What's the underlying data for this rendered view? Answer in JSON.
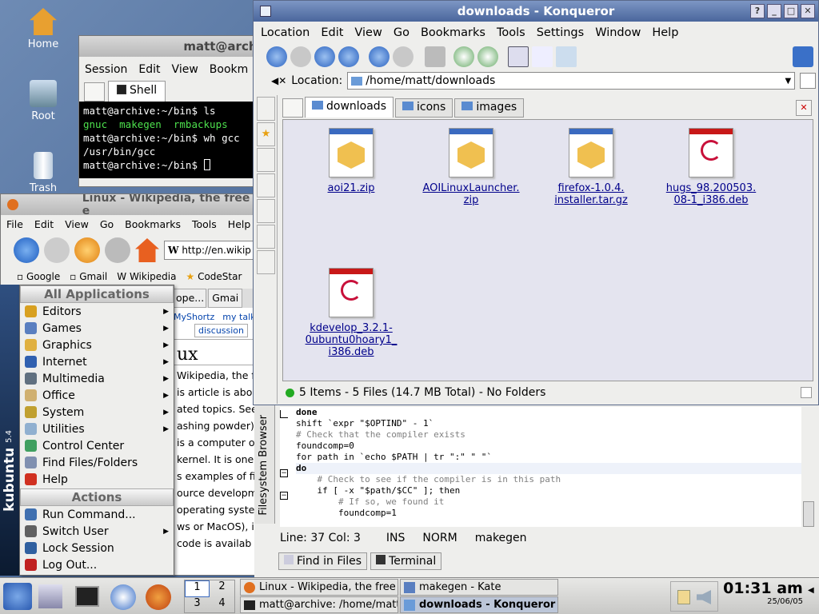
{
  "desktop": {
    "icons": [
      {
        "label": "Home"
      },
      {
        "label": "Root"
      },
      {
        "label": "Trash"
      }
    ]
  },
  "konsole": {
    "title": "matt@archi",
    "menu": [
      "Session",
      "Edit",
      "View",
      "Bookm"
    ],
    "tab": "Shell",
    "lines": [
      {
        "t": "matt@archive:~/bin$ ls",
        "c": "#fff"
      },
      {
        "t": "gnuc  makegen  rmbackups",
        "c": "#4de04d"
      },
      {
        "t": "matt@archive:~/bin$ wh gcc",
        "c": "#fff"
      },
      {
        "t": "/usr/bin/gcc",
        "c": "#fff"
      },
      {
        "t": "matt@archive:~/bin$ ",
        "c": "#fff"
      }
    ]
  },
  "firefox": {
    "title": "Linux - Wikipedia, the free e",
    "menu": [
      "File",
      "Edit",
      "View",
      "Go",
      "Bookmarks",
      "Tools",
      "Help"
    ],
    "url": "http://en.wikip",
    "bookmarks": [
      "Google",
      "Gmail",
      "Wikipedia",
      "CodeStar"
    ],
    "tabs": [
      "ope...",
      "Gmai"
    ],
    "links": [
      "MyShortz",
      "my talk"
    ],
    "subtab": "discussion",
    "heading": "ux",
    "body": [
      "Wikipedia, the fre",
      "is article is abou",
      "ated topics. See",
      "ashing powder)",
      "is a computer o",
      "kernel. It is one",
      "s examples of fi",
      "ource developm",
      "operating syste",
      "ws or MacOS), it",
      "code is availab"
    ]
  },
  "konqueror": {
    "title": "downloads - Konqueror",
    "menu": [
      "Location",
      "Edit",
      "View",
      "Go",
      "Bookmarks",
      "Tools",
      "Settings",
      "Window",
      "Help"
    ],
    "location_label": "Location:",
    "location": "/home/matt/downloads",
    "tabs": [
      "downloads",
      "icons",
      "images"
    ],
    "files": [
      {
        "l1": "aoi21.zip",
        "l2": "",
        "l3": "",
        "type": "TGZ"
      },
      {
        "l1": "AOILinuxLauncher.",
        "l2": "zip",
        "l3": "",
        "type": "TGZ"
      },
      {
        "l1": "firefox-1.0.4.",
        "l2": "installer.tar.gz",
        "l3": "",
        "type": "TGZ"
      },
      {
        "l1": "hugs_98.200503.",
        "l2": "08-1_i386.deb",
        "l3": "",
        "type": "DEB"
      },
      {
        "l1": "kdevelop_3.2.1-",
        "l2": "0ubuntu0hoary1_",
        "l3": "i386.deb",
        "type": "DEB"
      }
    ],
    "status": "5 Items - 5 Files (14.7 MB Total) - No Folders"
  },
  "kate": {
    "sidebar": "Filesystem Browser",
    "code": [
      {
        "t": "done",
        "c": "#000",
        "b": true
      },
      {
        "t": "shift `expr \"$OPTIND\" - 1`",
        "c": "#000",
        "b": false
      },
      {
        "t": "",
        "c": "#000",
        "b": false
      },
      {
        "t": "# Check that the compiler exists",
        "c": "#808080",
        "b": false
      },
      {
        "t": "foundcomp=0",
        "c": "#000",
        "b": false
      },
      {
        "t": "for path in `echo $PATH | tr \":\" \" \"`",
        "c": "#000",
        "b": false
      },
      {
        "t": "do",
        "c": "#000",
        "b": true
      },
      {
        "t": "    # Check to see if the compiler is in this path",
        "c": "#808080",
        "b": false
      },
      {
        "t": "    if [ -x \"$path/$CC\" ]; then",
        "c": "#000",
        "b": false
      },
      {
        "t": "        # If so, we found it",
        "c": "#808080",
        "b": false
      },
      {
        "t": "        foundcomp=1",
        "c": "#000",
        "b": false
      }
    ],
    "status": {
      "pos": "Line: 37 Col: 3",
      "ins": "INS",
      "norm": "NORM",
      "file": "makegen"
    },
    "bottom_tabs": [
      "Find in Files",
      "Terminal"
    ]
  },
  "kmenu": {
    "header": "All Applications",
    "apps": [
      {
        "l": "Editors",
        "a": true,
        "c": "#d8a020"
      },
      {
        "l": "Games",
        "a": true,
        "c": "#5a7fc0"
      },
      {
        "l": "Graphics",
        "a": true,
        "c": "#e0b040"
      },
      {
        "l": "Internet",
        "a": true,
        "c": "#3060b0"
      },
      {
        "l": "Multimedia",
        "a": true,
        "c": "#607080"
      },
      {
        "l": "Office",
        "a": true,
        "c": "#d0b070"
      },
      {
        "l": "System",
        "a": true,
        "c": "#c0a030"
      },
      {
        "l": "Utilities",
        "a": true,
        "c": "#90b0d0"
      },
      {
        "l": "Control Center",
        "a": false,
        "c": "#40a060"
      },
      {
        "l": "Find Files/Folders",
        "a": false,
        "c": "#8090b0"
      },
      {
        "l": "Help",
        "a": false,
        "c": "#d03020"
      }
    ],
    "actions_header": "Actions",
    "actions": [
      {
        "l": "Run Command...",
        "a": false,
        "c": "#4070b0"
      },
      {
        "l": "Switch User",
        "a": true,
        "c": "#606060"
      },
      {
        "l": "Lock Session",
        "a": false,
        "c": "#3060a0"
      },
      {
        "l": "Log Out...",
        "a": false,
        "c": "#c02020"
      }
    ],
    "side_brand": "kubuntu",
    "side_version": "5.4"
  },
  "taskbar": {
    "pager": [
      "1",
      "2",
      "3",
      "4"
    ],
    "tasks": [
      "Linux - Wikipedia, the free e",
      "makegen - Kate",
      "matt@archive: /home/matt/",
      "downloads - Konqueror"
    ],
    "clock": "01:31 am",
    "date": "25/06/05"
  }
}
